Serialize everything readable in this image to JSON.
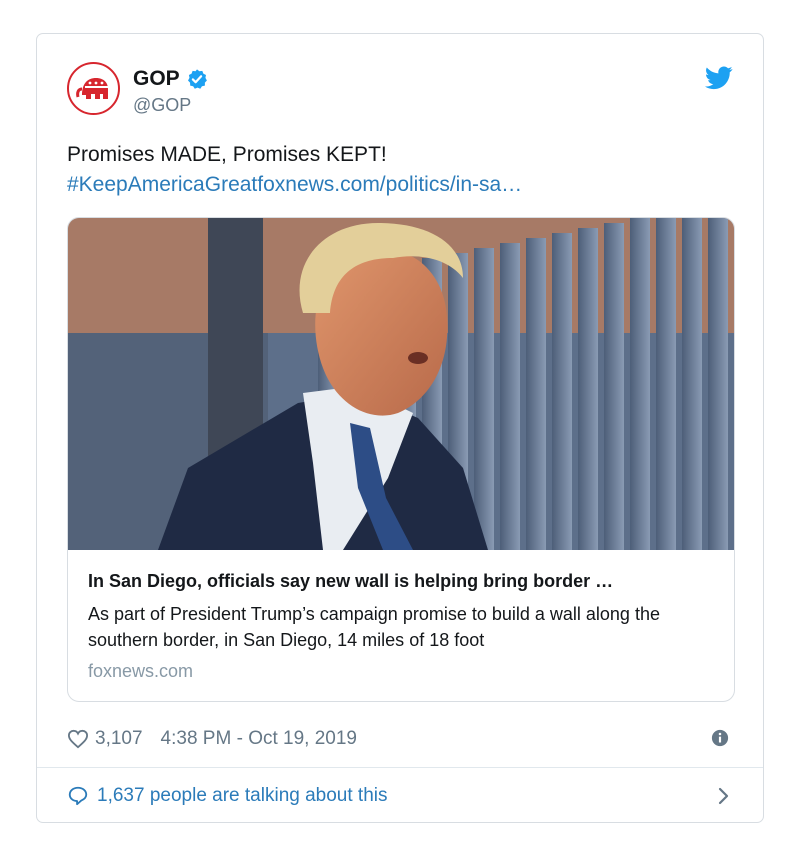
{
  "tweet": {
    "display_name": "GOP",
    "handle": "@GOP",
    "text": "Promises MADE, Promises KEPT!",
    "link": "#KeepAmericaGreatfoxnews.com/politics/in-sa…",
    "likes": "3,107",
    "timestamp": "4:38 PM - Oct 19, 2019",
    "talking": "1,637 people are talking about this"
  },
  "card": {
    "title": "In San Diego, officials say new wall is helping bring border …",
    "description": "As part of President Trump’s campaign promise to build a wall along the southern border, in San Diego, 14 miles of 18 foot",
    "domain": "foxnews.com"
  },
  "icons": {
    "avatar": "gop-elephant-logo",
    "verified": "verified-badge-icon",
    "brand": "twitter-bird-icon",
    "like": "heart-icon",
    "info": "info-icon",
    "reply": "speech-bubble-icon",
    "more": "chevron-right-icon"
  },
  "colors": {
    "link": "#2b7bb9",
    "brand": "#1da1f2",
    "gop_red": "#d7262e",
    "muted": "#657786"
  }
}
